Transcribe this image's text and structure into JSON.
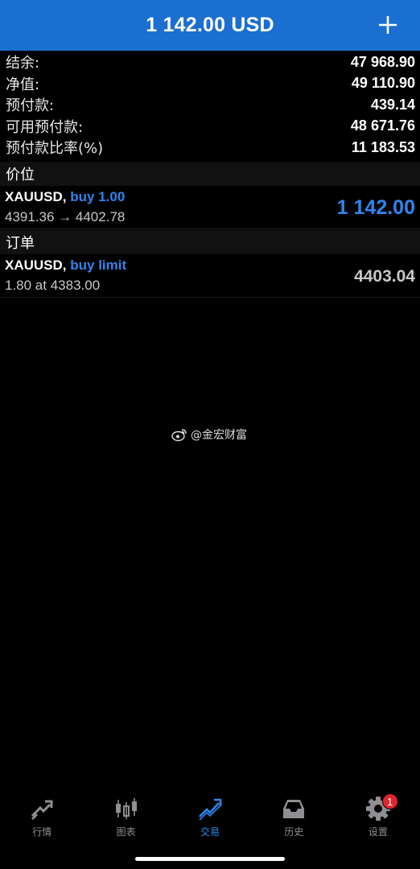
{
  "header": {
    "title": "1 142.00 USD",
    "add_icon": "plus-icon"
  },
  "summary": [
    {
      "label": "结余:",
      "value": "47 968.90"
    },
    {
      "label": "净值:",
      "value": "49 110.90"
    },
    {
      "label": "预付款:",
      "value": "439.14"
    },
    {
      "label": "可用预付款:",
      "value": "48 671.76"
    },
    {
      "label": "预付款比率(%)",
      "value": "11 183.53"
    }
  ],
  "positions": {
    "title": "价位",
    "items": [
      {
        "symbol": "XAUUSD,",
        "type": "buy 1.00",
        "detail": "4391.36 → 4402.78",
        "profit": "1 142.00",
        "profit_color": "#2e86ee"
      }
    ]
  },
  "orders": {
    "title": "订单",
    "items": [
      {
        "symbol": "XAUUSD,",
        "type": "buy limit",
        "detail": "1.80 at 4383.00",
        "price": "4403.04",
        "price_color": "#c8c8c8"
      }
    ]
  },
  "watermark": {
    "text": "@金宏财富",
    "icon": "weibo-icon"
  },
  "tabbar": {
    "tabs": [
      {
        "label": "行情",
        "icon": "quotes-icon",
        "active": false
      },
      {
        "label": "图表",
        "icon": "chart-icon",
        "active": false
      },
      {
        "label": "交易",
        "icon": "trade-icon",
        "active": true
      },
      {
        "label": "历史",
        "icon": "history-icon",
        "active": false
      },
      {
        "label": "设置",
        "icon": "settings-icon",
        "active": false,
        "badge": "1"
      }
    ]
  },
  "colors": {
    "header_bg": "#1a6fd0",
    "accent": "#2e86ee",
    "badge": "#e0262c"
  }
}
